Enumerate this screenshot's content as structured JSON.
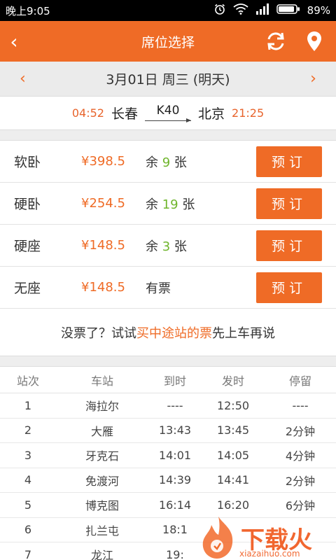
{
  "status_bar": {
    "time": "晚上9:05",
    "battery": "89%"
  },
  "app_bar": {
    "title": "席位选择",
    "back_icon": "‹"
  },
  "date_bar": {
    "prev": "‹",
    "date": "3月01日 周三 (明天)",
    "next": "›"
  },
  "train": {
    "depart_time": "04:52",
    "from": "长春",
    "train_no": "K40",
    "to": "北京",
    "arrive_time": "21:25"
  },
  "seats": [
    {
      "type": "软卧",
      "price": "¥398.5",
      "remain_prefix": "余",
      "remain_num": "9",
      "remain_suffix": "张",
      "book_label": "预订"
    },
    {
      "type": "硬卧",
      "price": "¥254.5",
      "remain_prefix": "余",
      "remain_num": "19",
      "remain_suffix": "张",
      "book_label": "预订"
    },
    {
      "type": "硬座",
      "price": "¥148.5",
      "remain_prefix": "余",
      "remain_num": "3",
      "remain_suffix": "张",
      "book_label": "预订"
    },
    {
      "type": "无座",
      "price": "¥148.5",
      "remain_prefix": "有票",
      "remain_num": "",
      "remain_suffix": "",
      "book_label": "预订"
    }
  ],
  "tip": {
    "before": "没票了？试试",
    "link": "买中途站的票",
    "after": "先上车再说"
  },
  "stops": {
    "headers": [
      "站次",
      "车站",
      "到时",
      "发时",
      "停留"
    ],
    "rows": [
      [
        "1",
        "海拉尔",
        "----",
        "12:50",
        "----"
      ],
      [
        "2",
        "大雁",
        "13:43",
        "13:45",
        "2分钟"
      ],
      [
        "3",
        "牙克石",
        "14:01",
        "14:05",
        "4分钟"
      ],
      [
        "4",
        "免渡河",
        "14:39",
        "14:41",
        "2分钟"
      ],
      [
        "5",
        "博克图",
        "16:14",
        "16:20",
        "6分钟"
      ],
      [
        "6",
        "扎兰屯",
        "18:1",
        "",
        ""
      ],
      [
        "7",
        "龙江",
        "19:",
        "",
        ""
      ]
    ]
  },
  "watermark": {
    "text": "下载火",
    "sub": "xiazaihuo.com"
  },
  "colors": {
    "accent": "#ef6b26",
    "remain_green": "#6fb52c"
  }
}
